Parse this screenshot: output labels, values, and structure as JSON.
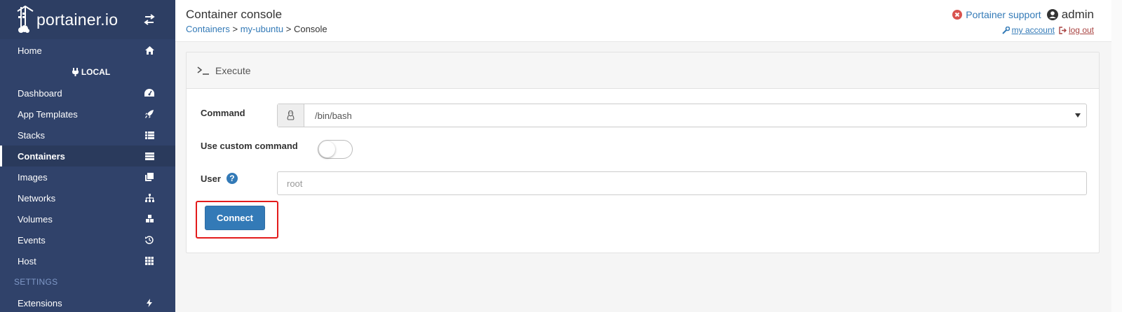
{
  "sidebar": {
    "brand": "portainer.io",
    "items": [
      {
        "label": "Home",
        "icon": "home-icon"
      },
      {
        "label": "Dashboard",
        "icon": "tachometer-icon"
      },
      {
        "label": "App Templates",
        "icon": "rocket-icon"
      },
      {
        "label": "Stacks",
        "icon": "th-list-icon"
      },
      {
        "label": "Containers",
        "icon": "server-icon"
      },
      {
        "label": "Images",
        "icon": "clone-icon"
      },
      {
        "label": "Networks",
        "icon": "sitemap-icon"
      },
      {
        "label": "Volumes",
        "icon": "cubes-icon"
      },
      {
        "label": "Events",
        "icon": "history-icon"
      },
      {
        "label": "Host",
        "icon": "th-icon"
      },
      {
        "label": "Extensions",
        "icon": "bolt-icon"
      }
    ],
    "endpoint": "LOCAL",
    "settings_heading": "SETTINGS",
    "active": "Containers"
  },
  "header": {
    "title": "Container console",
    "breadcrumb": {
      "containers": "Containers",
      "sep1": " > ",
      "container": "my-ubuntu",
      "sep2": " > ",
      "current": "Console"
    },
    "support": "Portainer support",
    "user": "admin",
    "my_account": " my account ",
    "logout": " log out"
  },
  "widget": {
    "title": "Execute",
    "command_label": "Command",
    "command_value": "/bin/bash",
    "custom_label": "Use custom command",
    "custom_enabled": false,
    "user_label": "User",
    "user_placeholder": "root",
    "connect_label": "Connect"
  },
  "colors": {
    "sidebar_bg": "#30426a",
    "primary": "#337ab7",
    "highlight": "#e31b1b",
    "logout": "#a94442"
  }
}
